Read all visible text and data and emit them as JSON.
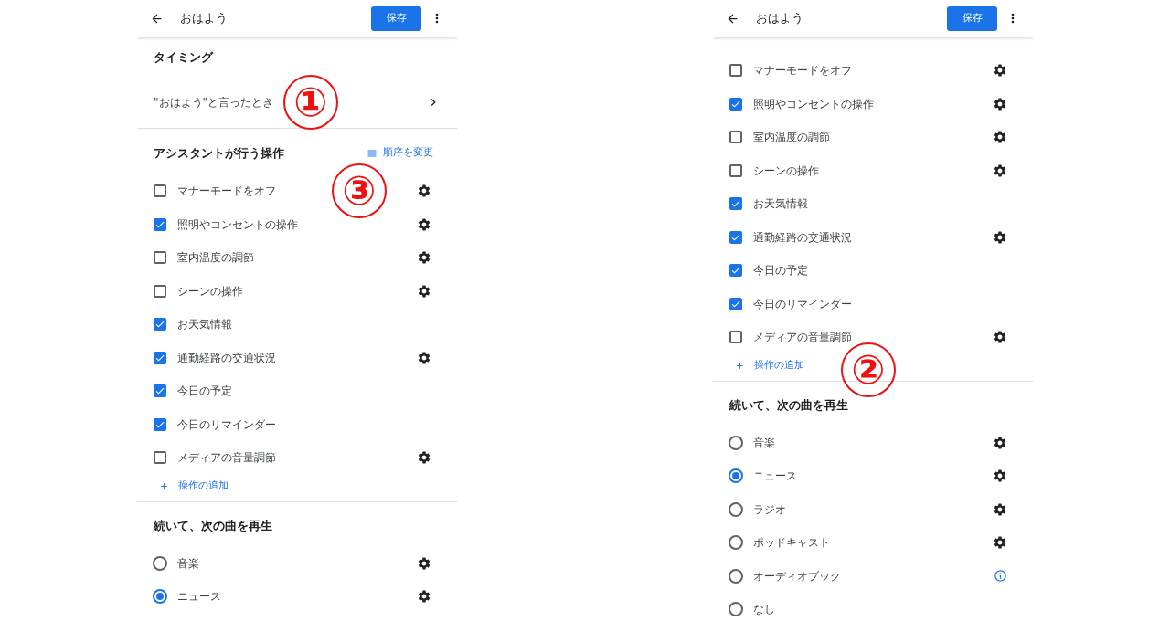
{
  "screens": [
    {
      "title": "おはよう",
      "save_button": "保存",
      "blocks": [
        {
          "kind": "heading",
          "text": "タイミング"
        },
        {
          "kind": "link",
          "text": "\"おはよう\"と言ったとき",
          "marker": "①"
        },
        {
          "kind": "divider"
        },
        {
          "kind": "headingaction",
          "text": "アシスタントが行う操作",
          "action": "順序を変更",
          "marker": "③"
        },
        {
          "kind": "checkcog",
          "text": "マナーモードをオフ",
          "checked": false
        },
        {
          "kind": "checkcog",
          "text": "照明やコンセントの操作",
          "checked": true
        },
        {
          "kind": "checkcog",
          "text": "室内温度の調節",
          "checked": false
        },
        {
          "kind": "checkcog",
          "text": "シーンの操作",
          "checked": false
        },
        {
          "kind": "check",
          "text": "お天気情報",
          "checked": true
        },
        {
          "kind": "checkcog",
          "text": "通勤経路の交通状況",
          "checked": true
        },
        {
          "kind": "check",
          "text": "今日の予定",
          "checked": true
        },
        {
          "kind": "check",
          "text": "今日のリマインダー",
          "checked": true
        },
        {
          "kind": "checkcog",
          "text": "メディアの音量調節",
          "checked": false
        },
        {
          "kind": "add",
          "text": "操作の追加"
        },
        {
          "kind": "divider"
        },
        {
          "kind": "heading",
          "text": "続いて、次の曲を再生"
        },
        {
          "kind": "radiocog",
          "text": "音楽",
          "selected": false
        },
        {
          "kind": "radiocog",
          "text": "ニュース",
          "selected": true
        }
      ]
    },
    {
      "title": "おはよう",
      "save_button": "保存",
      "blocks": [
        {
          "kind": "spacer"
        },
        {
          "kind": "checkcog",
          "text": "マナーモードをオフ",
          "checked": false
        },
        {
          "kind": "checkcog",
          "text": "照明やコンセントの操作",
          "checked": true
        },
        {
          "kind": "checkcog",
          "text": "室内温度の調節",
          "checked": false
        },
        {
          "kind": "checkcog",
          "text": "シーンの操作",
          "checked": false
        },
        {
          "kind": "check",
          "text": "お天気情報",
          "checked": true
        },
        {
          "kind": "checkcog",
          "text": "通勤経路の交通状況",
          "checked": true
        },
        {
          "kind": "check",
          "text": "今日の予定",
          "checked": true
        },
        {
          "kind": "check",
          "text": "今日のリマインダー",
          "checked": true
        },
        {
          "kind": "checkcog",
          "text": "メディアの音量調節",
          "checked": false
        },
        {
          "kind": "add",
          "text": "操作の追加",
          "marker": "②"
        },
        {
          "kind": "divider"
        },
        {
          "kind": "heading",
          "text": "続いて、次の曲を再生"
        },
        {
          "kind": "radiocog",
          "text": "音楽",
          "selected": false
        },
        {
          "kind": "radiocog",
          "text": "ニュース",
          "selected": true
        },
        {
          "kind": "radiocog",
          "text": "ラジオ",
          "selected": false
        },
        {
          "kind": "radiocog",
          "text": "ポッドキャスト",
          "selected": false
        },
        {
          "kind": "radioinfo",
          "text": "オーディオブック",
          "selected": false
        },
        {
          "kind": "radio",
          "text": "なし",
          "selected": false
        }
      ]
    }
  ]
}
